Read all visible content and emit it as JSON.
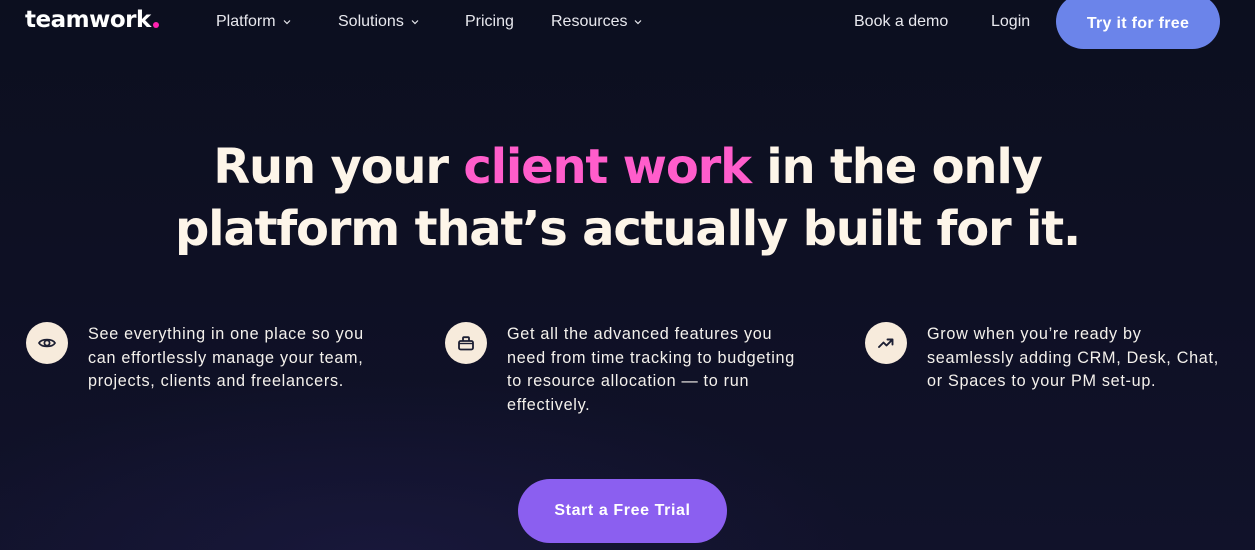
{
  "colors": {
    "background": "#0d0f20",
    "logo_dot": "#ff22b0",
    "headline_text": "#fdf5e9",
    "headline_accent": "#ff5dcb",
    "try_button_bg": "#6b84ea",
    "cta_button_bg": "#8b5ff0",
    "feature_icon_bg": "#f7ebdc",
    "feature_icon_glyph": "#1c1f33"
  },
  "nav": {
    "logo_text": "teamwork",
    "logo_dot_icon": "dot-icon",
    "items": [
      {
        "label": "Platform",
        "has_dropdown": true,
        "icon": "chevron-down-icon"
      },
      {
        "label": "Solutions",
        "has_dropdown": true,
        "icon": "chevron-down-icon"
      },
      {
        "label": "Pricing",
        "has_dropdown": false
      },
      {
        "label": "Resources",
        "has_dropdown": true,
        "icon": "chevron-down-icon"
      }
    ],
    "book_demo": "Book a demo",
    "login": "Login",
    "try_free": "Try it for free"
  },
  "hero": {
    "line1_before": "Run your ",
    "line1_accent": "client work",
    "line1_after": " in the only",
    "line2": "platform that’s actually built for it."
  },
  "features": [
    {
      "icon": "eye-icon",
      "text": "See everything in one place so you can effortlessly manage your team, projects, clients and freelancers."
    },
    {
      "icon": "briefcase-icon",
      "text": "Get all the advanced features you need from time tracking to budgeting to resource allocation — to run effectively."
    },
    {
      "icon": "trending-up-icon",
      "text": "Grow when you’re ready by seamlessly adding CRM, Desk, Chat, or Spaces to your PM set-up."
    }
  ],
  "cta": {
    "label": "Start a Free Trial"
  }
}
